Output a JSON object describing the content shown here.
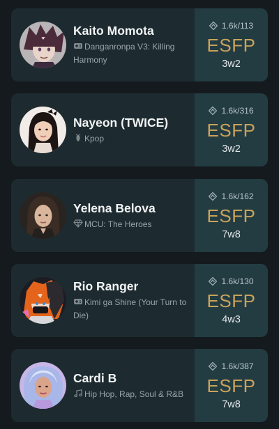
{
  "cards": [
    {
      "name": "Kaito Momota",
      "category_icon": "gamepad-icon",
      "source": "Danganronpa V3: Killing Harmony",
      "votes": "1.6k/113",
      "mbti": "ESFP",
      "enneagram": "3w2",
      "colors": {
        "hair": "#4b2a3a",
        "skin": "#e8d4c8",
        "bg": "#b9b4b6"
      }
    },
    {
      "name": "Nayeon (TWICE)",
      "category_icon": "kpop-icon",
      "source": "Kpop",
      "votes": "1.6k/316",
      "mbti": "ESFP",
      "enneagram": "3w2",
      "colors": {
        "hair": "#1c1412",
        "skin": "#efcfb7",
        "bg": "#f2ece8"
      }
    },
    {
      "name": "Yelena Belova",
      "category_icon": "gem-icon",
      "source": "MCU: The Heroes",
      "votes": "1.6k/162",
      "mbti": "ESFP",
      "enneagram": "7w8",
      "colors": {
        "hair": "#3b2d24",
        "skin": "#d9b59c",
        "bg": "#2a2420"
      }
    },
    {
      "name": "Rio Ranger",
      "category_icon": "gamepad-icon",
      "source": "Kimi ga Shine (Your Turn to Die)",
      "votes": "1.6k/130",
      "mbti": "ESFP",
      "enneagram": "4w3",
      "colors": {
        "hair": "#e4641c",
        "skin": "#f3d9c9",
        "bg": "#1c1c22"
      }
    },
    {
      "name": "Cardi B",
      "category_icon": "music-note-icon",
      "source": "Hip Hop, Rap, Soul & R&B",
      "votes": "1.6k/387",
      "mbti": "ESFP",
      "enneagram": "7w8",
      "colors": {
        "hair": "#a9b6e8",
        "skin": "#d9a48a",
        "bg": "#c8b6e6"
      }
    }
  ],
  "theme": {
    "background": "#141a1d",
    "card": "#1d2b30",
    "card_right": "#233c42",
    "mbti_color": "#c9a25a"
  }
}
